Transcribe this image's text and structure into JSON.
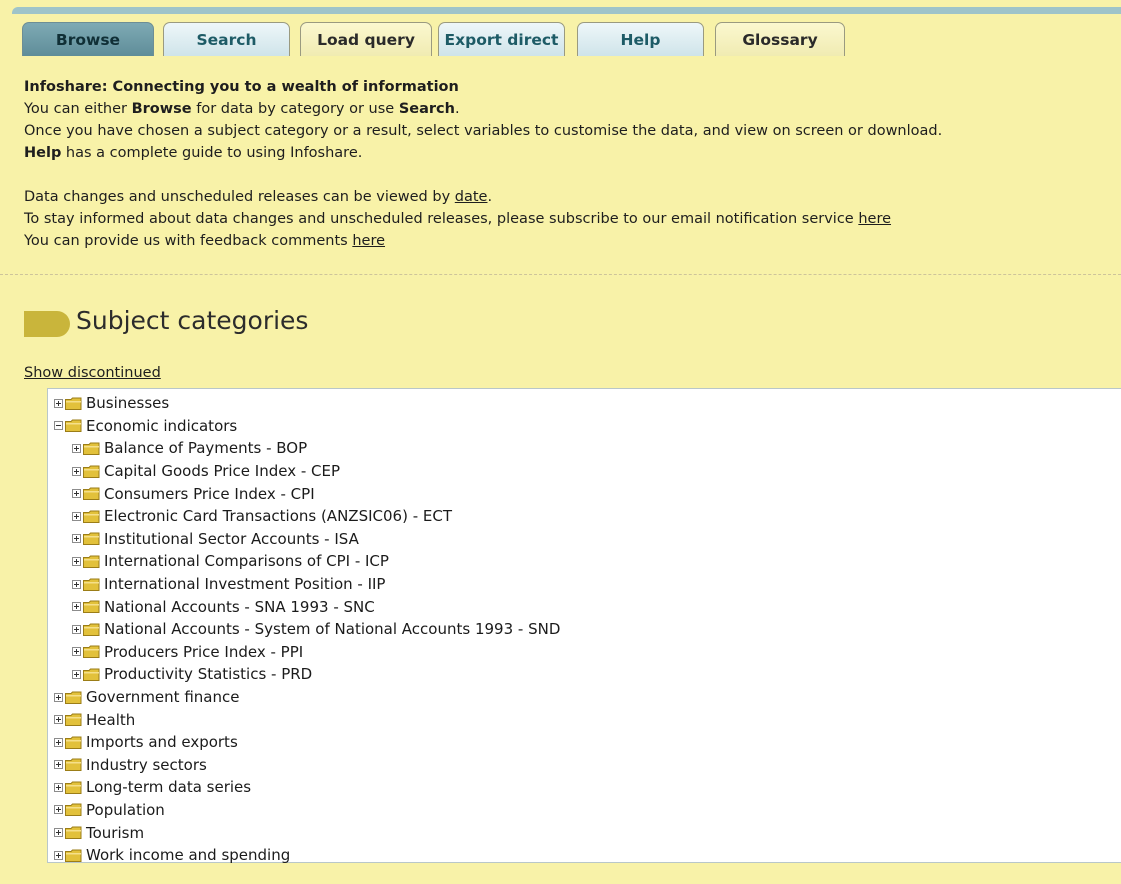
{
  "tabs": [
    {
      "label": "Browse",
      "active": true
    },
    {
      "label": "Search"
    },
    {
      "label": "Load query"
    },
    {
      "label": "Export direct"
    },
    {
      "label": "Help"
    },
    {
      "label": "Glossary"
    }
  ],
  "intro": {
    "heading": "Infoshare: Connecting you to a wealth of information",
    "line1_pre": "You can either ",
    "line1_browse": "Browse",
    "line1_mid": " for data by category or use ",
    "line1_search": "Search",
    "line1_end": ".",
    "line2": "Once you have chosen a subject category or a result, select variables to customise the data, and view on screen or download.",
    "line3_help": "Help",
    "line3_rest": " has a complete guide to using Infoshare.",
    "line4_pre": "Data changes and unscheduled releases can be viewed by ",
    "line4_link": "date",
    "line4_end": ".",
    "line5_pre": "To stay informed about data changes and unscheduled releases, please subscribe to our email notification service ",
    "line5_link": "here",
    "line6_pre": "You can provide us with feedback comments ",
    "line6_link": "here"
  },
  "subject_title": "Subject categories",
  "show_discontinued": "Show discontinued",
  "tree": [
    {
      "label": "Businesses",
      "level": 0,
      "expanded": false
    },
    {
      "label": "Economic indicators",
      "level": 0,
      "expanded": true
    },
    {
      "label": "Balance of Payments - BOP",
      "level": 1,
      "expanded": false
    },
    {
      "label": "Capital Goods Price Index - CEP",
      "level": 1,
      "expanded": false
    },
    {
      "label": "Consumers Price Index - CPI",
      "level": 1,
      "expanded": false
    },
    {
      "label": "Electronic Card Transactions (ANZSIC06) - ECT",
      "level": 1,
      "expanded": false
    },
    {
      "label": "Institutional Sector Accounts - ISA",
      "level": 1,
      "expanded": false
    },
    {
      "label": "International Comparisons of CPI - ICP",
      "level": 1,
      "expanded": false
    },
    {
      "label": "International Investment Position - IIP",
      "level": 1,
      "expanded": false
    },
    {
      "label": "National Accounts - SNA 1993 - SNC",
      "level": 1,
      "expanded": false
    },
    {
      "label": "National Accounts - System of National Accounts 1993 - SND",
      "level": 1,
      "expanded": false
    },
    {
      "label": "Producers Price Index - PPI",
      "level": 1,
      "expanded": false
    },
    {
      "label": "Productivity Statistics - PRD",
      "level": 1,
      "expanded": false
    },
    {
      "label": "Government finance",
      "level": 0,
      "expanded": false
    },
    {
      "label": "Health",
      "level": 0,
      "expanded": false
    },
    {
      "label": "Imports and exports",
      "level": 0,
      "expanded": false
    },
    {
      "label": "Industry sectors",
      "level": 0,
      "expanded": false
    },
    {
      "label": "Long-term data series",
      "level": 0,
      "expanded": false
    },
    {
      "label": "Population",
      "level": 0,
      "expanded": false
    },
    {
      "label": "Tourism",
      "level": 0,
      "expanded": false
    },
    {
      "label": "Work income and spending",
      "level": 0,
      "expanded": false
    }
  ],
  "colors": {
    "page_background": "#f8f2a8",
    "active_tab": "#6f9ba6",
    "tab_text": "#1d5b66",
    "folder": "#e2c13b"
  }
}
